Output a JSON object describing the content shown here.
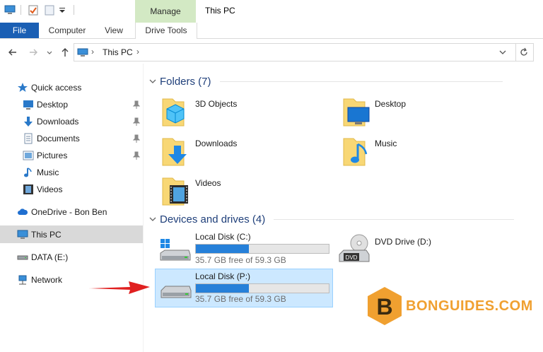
{
  "window": {
    "title": "This PC"
  },
  "ribbon": {
    "context_group": "Manage",
    "tabs": [
      {
        "label": "File"
      },
      {
        "label": "Computer"
      },
      {
        "label": "View"
      },
      {
        "label": "Drive Tools"
      }
    ]
  },
  "address": {
    "crumb": "This PC"
  },
  "sidebar": {
    "items": [
      {
        "label": "Quick access"
      },
      {
        "label": "Desktop"
      },
      {
        "label": "Downloads"
      },
      {
        "label": "Documents"
      },
      {
        "label": "Pictures"
      },
      {
        "label": "Music"
      },
      {
        "label": "Videos"
      },
      {
        "label": "OneDrive - Bon Ben"
      },
      {
        "label": "This PC"
      },
      {
        "label": "DATA (E:)"
      },
      {
        "label": "Network"
      }
    ]
  },
  "folders": {
    "header": "Folders (7)",
    "items": [
      {
        "label": "3D Objects"
      },
      {
        "label": "Desktop"
      },
      {
        "label": "Downloads"
      },
      {
        "label": "Music"
      },
      {
        "label": "Videos"
      }
    ]
  },
  "drives": {
    "header": "Devices and drives (4)",
    "items": [
      {
        "name": "Local Disk (C:)",
        "free": "35.7 GB free of 59.3 GB",
        "used_fraction": 0.4
      },
      {
        "name": "DVD Drive (D:)"
      },
      {
        "name": "Local Disk (P:)",
        "free": "35.7 GB free of 59.3 GB",
        "used_fraction": 0.4
      }
    ]
  },
  "watermark": {
    "text": "BONGUIDES.COM",
    "letter": "B"
  },
  "colors": {
    "accent": "#1a5fb4",
    "manage_bg": "#d3e9c4",
    "selection": "#cce8ff",
    "bar_fill": "#2680d9",
    "arrow": "#e02020",
    "logo": "#f0a030"
  }
}
